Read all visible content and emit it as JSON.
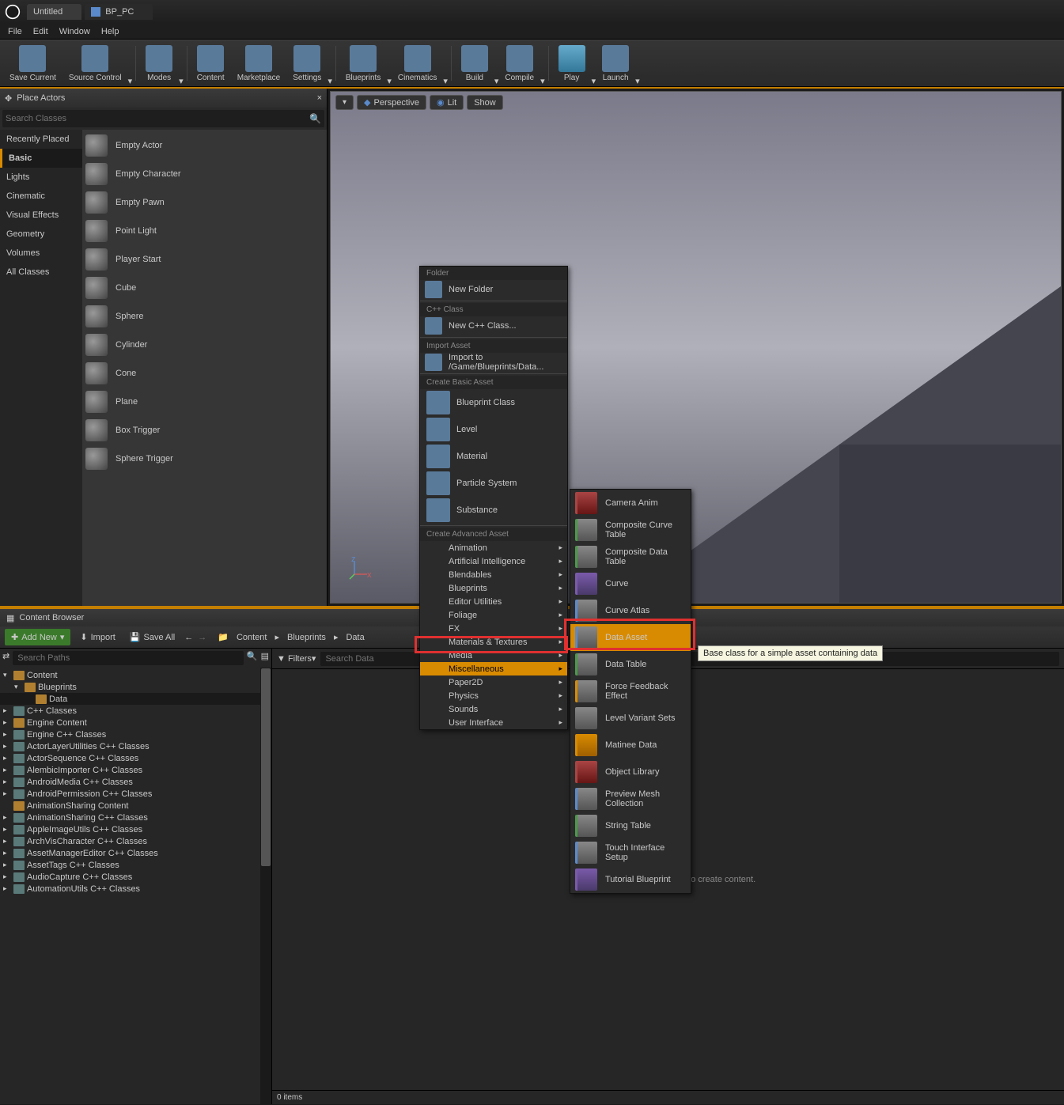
{
  "tabs": [
    {
      "label": "Untitled"
    },
    {
      "label": "BP_PC"
    }
  ],
  "menu": [
    "File",
    "Edit",
    "Window",
    "Help"
  ],
  "toolbar": [
    {
      "label": "Save Current"
    },
    {
      "label": "Source Control"
    },
    {
      "label": "Modes"
    },
    {
      "label": "Content"
    },
    {
      "label": "Marketplace"
    },
    {
      "label": "Settings"
    },
    {
      "label": "Blueprints"
    },
    {
      "label": "Cinematics"
    },
    {
      "label": "Build"
    },
    {
      "label": "Compile"
    },
    {
      "label": "Play"
    },
    {
      "label": "Launch"
    }
  ],
  "placeActors": {
    "title": "Place Actors",
    "searchPlaceholder": "Search Classes",
    "categories": [
      "Recently Placed",
      "Basic",
      "Lights",
      "Cinematic",
      "Visual Effects",
      "Geometry",
      "Volumes",
      "All Classes"
    ],
    "selectedCategory": "Basic",
    "items": [
      "Empty Actor",
      "Empty Character",
      "Empty Pawn",
      "Point Light",
      "Player Start",
      "Cube",
      "Sphere",
      "Cylinder",
      "Cone",
      "Plane",
      "Box Trigger",
      "Sphere Trigger"
    ]
  },
  "viewport": {
    "buttons": [
      "Perspective",
      "Lit",
      "Show"
    ]
  },
  "contentBrowser": {
    "title": "Content Browser",
    "addNew": "Add New",
    "import": "Import",
    "saveAll": "Save All",
    "breadcrumb": [
      "Content",
      "Blueprints",
      "Data"
    ],
    "searchPathsPlaceholder": "Search Paths",
    "filtersLabel": "Filters",
    "searchDataPlaceholder": "Search Data",
    "emptyHint": "Drop files here or right click to create content.",
    "itemCount": "0 items",
    "tree": [
      {
        "label": "Content",
        "depth": 0,
        "icon": "fold",
        "exp": "▾"
      },
      {
        "label": "Blueprints",
        "depth": 1,
        "icon": "fold",
        "exp": "▾"
      },
      {
        "label": "Data",
        "depth": 2,
        "icon": "fold",
        "exp": "",
        "sel": true
      },
      {
        "label": "C++ Classes",
        "depth": 0,
        "icon": "cpp",
        "exp": "▸"
      },
      {
        "label": "Engine Content",
        "depth": 0,
        "icon": "fold",
        "exp": "▸"
      },
      {
        "label": "Engine C++ Classes",
        "depth": 0,
        "icon": "cpp",
        "exp": "▸"
      },
      {
        "label": "ActorLayerUtilities C++ Classes",
        "depth": 0,
        "icon": "cpp",
        "exp": "▸"
      },
      {
        "label": "ActorSequence C++ Classes",
        "depth": 0,
        "icon": "cpp",
        "exp": "▸"
      },
      {
        "label": "AlembicImporter C++ Classes",
        "depth": 0,
        "icon": "cpp",
        "exp": "▸"
      },
      {
        "label": "AndroidMedia C++ Classes",
        "depth": 0,
        "icon": "cpp",
        "exp": "▸"
      },
      {
        "label": "AndroidPermission C++ Classes",
        "depth": 0,
        "icon": "cpp",
        "exp": "▸"
      },
      {
        "label": "AnimationSharing Content",
        "depth": 0,
        "icon": "fold",
        "exp": ""
      },
      {
        "label": "AnimationSharing C++ Classes",
        "depth": 0,
        "icon": "cpp",
        "exp": "▸"
      },
      {
        "label": "AppleImageUtils C++ Classes",
        "depth": 0,
        "icon": "cpp",
        "exp": "▸"
      },
      {
        "label": "ArchVisCharacter C++ Classes",
        "depth": 0,
        "icon": "cpp",
        "exp": "▸"
      },
      {
        "label": "AssetManagerEditor C++ Classes",
        "depth": 0,
        "icon": "cpp",
        "exp": "▸"
      },
      {
        "label": "AssetTags C++ Classes",
        "depth": 0,
        "icon": "cpp",
        "exp": "▸"
      },
      {
        "label": "AudioCapture C++ Classes",
        "depth": 0,
        "icon": "cpp",
        "exp": "▸"
      },
      {
        "label": "AutomationUtils C++ Classes",
        "depth": 0,
        "icon": "cpp",
        "exp": "▸"
      }
    ]
  },
  "contextMenu": {
    "sections": {
      "folder": "Folder",
      "cpp": "C++ Class",
      "import": "Import Asset",
      "basic": "Create Basic Asset",
      "advanced": "Create Advanced Asset"
    },
    "newFolder": "New Folder",
    "newCpp": "New C++ Class...",
    "importTo": "Import to /Game/Blueprints/Data...",
    "basic": [
      "Blueprint Class",
      "Level",
      "Material",
      "Particle System",
      "Substance"
    ],
    "advanced": [
      "Animation",
      "Artificial Intelligence",
      "Blendables",
      "Blueprints",
      "Editor Utilities",
      "Foliage",
      "FX",
      "Materials & Textures",
      "Media",
      "Miscellaneous",
      "Paper2D",
      "Physics",
      "Sounds",
      "User Interface"
    ]
  },
  "submenu": [
    "Camera Anim",
    "Composite Curve Table",
    "Composite Data Table",
    "Curve",
    "Curve Atlas",
    "Data Asset",
    "Data Table",
    "Force Feedback Effect",
    "Level Variant Sets",
    "Matinee Data",
    "Object Library",
    "Preview Mesh Collection",
    "String Table",
    "Touch Interface Setup",
    "Tutorial Blueprint"
  ],
  "tooltip": "Base class for a simple asset containing data"
}
